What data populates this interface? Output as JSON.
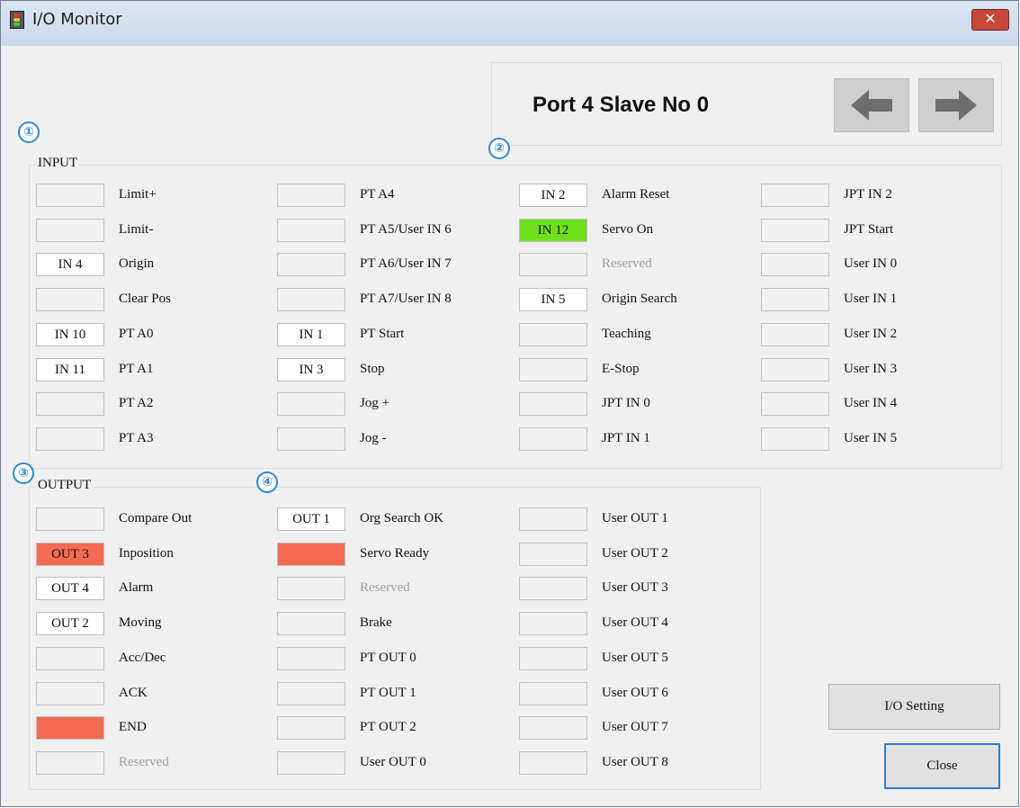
{
  "window": {
    "title": "I/O Monitor",
    "close_glyph": "✕"
  },
  "port": {
    "title": "Port 4 Slave No 0",
    "prev_icon": "arrow-left-icon",
    "next_icon": "arrow-right-icon"
  },
  "callouts": [
    "①",
    "②",
    "③",
    "④"
  ],
  "input": {
    "label": "INPUT",
    "columns": [
      [
        {
          "box": "",
          "label": "Limit+",
          "state": "off"
        },
        {
          "box": "",
          "label": "Limit-",
          "state": "off"
        },
        {
          "box": "IN 4",
          "label": "Origin",
          "state": "on"
        },
        {
          "box": "",
          "label": "Clear Pos",
          "state": "off"
        },
        {
          "box": "IN 10",
          "label": "PT A0",
          "state": "on"
        },
        {
          "box": "IN 11",
          "label": "PT A1",
          "state": "on"
        },
        {
          "box": "",
          "label": "PT A2",
          "state": "off"
        },
        {
          "box": "",
          "label": "PT A3",
          "state": "off"
        }
      ],
      [
        {
          "box": "",
          "label": "PT A4",
          "state": "off"
        },
        {
          "box": "",
          "label": "PT A5/User IN 6",
          "state": "off"
        },
        {
          "box": "",
          "label": "PT A6/User IN 7",
          "state": "off"
        },
        {
          "box": "",
          "label": "PT A7/User IN 8",
          "state": "off"
        },
        {
          "box": "IN 1",
          "label": "PT Start",
          "state": "on"
        },
        {
          "box": "IN 3",
          "label": "Stop",
          "state": "on"
        },
        {
          "box": "",
          "label": "Jog +",
          "state": "off"
        },
        {
          "box": "",
          "label": "Jog -",
          "state": "off"
        }
      ],
      [
        {
          "box": "IN 2",
          "label": "Alarm Reset",
          "state": "on"
        },
        {
          "box": "IN 12",
          "label": "Servo On",
          "state": "green"
        },
        {
          "box": "",
          "label": "Reserved",
          "state": "off",
          "dim": true
        },
        {
          "box": "IN 5",
          "label": "Origin Search",
          "state": "on"
        },
        {
          "box": "",
          "label": "Teaching",
          "state": "off"
        },
        {
          "box": "",
          "label": "E-Stop",
          "state": "off"
        },
        {
          "box": "",
          "label": "JPT IN 0",
          "state": "off"
        },
        {
          "box": "",
          "label": "JPT IN 1",
          "state": "off"
        }
      ],
      [
        {
          "box": "",
          "label": "JPT IN 2",
          "state": "off"
        },
        {
          "box": "",
          "label": "JPT Start",
          "state": "off"
        },
        {
          "box": "",
          "label": "User IN 0",
          "state": "off"
        },
        {
          "box": "",
          "label": "User IN 1",
          "state": "off"
        },
        {
          "box": "",
          "label": "User IN 2",
          "state": "off"
        },
        {
          "box": "",
          "label": "User IN 3",
          "state": "off"
        },
        {
          "box": "",
          "label": "User IN 4",
          "state": "off"
        },
        {
          "box": "",
          "label": "User IN 5",
          "state": "off"
        }
      ]
    ]
  },
  "output": {
    "label": "OUTPUT",
    "columns": [
      [
        {
          "box": "",
          "label": "Compare Out",
          "state": "off"
        },
        {
          "box": "OUT 3",
          "label": "Inposition",
          "state": "red"
        },
        {
          "box": "OUT 4",
          "label": "Alarm",
          "state": "on"
        },
        {
          "box": "OUT 2",
          "label": "Moving",
          "state": "on"
        },
        {
          "box": "",
          "label": "Acc/Dec",
          "state": "off"
        },
        {
          "box": "",
          "label": "ACK",
          "state": "off"
        },
        {
          "box": "",
          "label": "END",
          "state": "red"
        },
        {
          "box": "",
          "label": "Reserved",
          "state": "off",
          "dim": true
        }
      ],
      [
        {
          "box": "OUT 1",
          "label": "Org Search OK",
          "state": "on"
        },
        {
          "box": "",
          "label": "Servo Ready",
          "state": "red"
        },
        {
          "box": "",
          "label": "Reserved",
          "state": "off",
          "dim": true
        },
        {
          "box": "",
          "label": "Brake",
          "state": "off"
        },
        {
          "box": "",
          "label": "PT OUT 0",
          "state": "off"
        },
        {
          "box": "",
          "label": "PT OUT 1",
          "state": "off"
        },
        {
          "box": "",
          "label": "PT OUT 2",
          "state": "off"
        },
        {
          "box": "",
          "label": "User OUT 0",
          "state": "off"
        }
      ],
      [
        {
          "box": "",
          "label": "User OUT 1",
          "state": "off"
        },
        {
          "box": "",
          "label": "User OUT 2",
          "state": "off"
        },
        {
          "box": "",
          "label": "User OUT 3",
          "state": "off"
        },
        {
          "box": "",
          "label": "User OUT 4",
          "state": "off"
        },
        {
          "box": "",
          "label": "User OUT 5",
          "state": "off"
        },
        {
          "box": "",
          "label": "User OUT 6",
          "state": "off"
        },
        {
          "box": "",
          "label": "User OUT 7",
          "state": "off"
        },
        {
          "box": "",
          "label": "User OUT 8",
          "state": "off"
        }
      ]
    ]
  },
  "buttons": {
    "io_setting": "I/O Setting",
    "close": "Close"
  },
  "colors": {
    "on": "#ffffff",
    "off": "#f0f0f0",
    "green": "#6ee01b",
    "red": "#f56a52",
    "callout": "#2f89d4"
  }
}
